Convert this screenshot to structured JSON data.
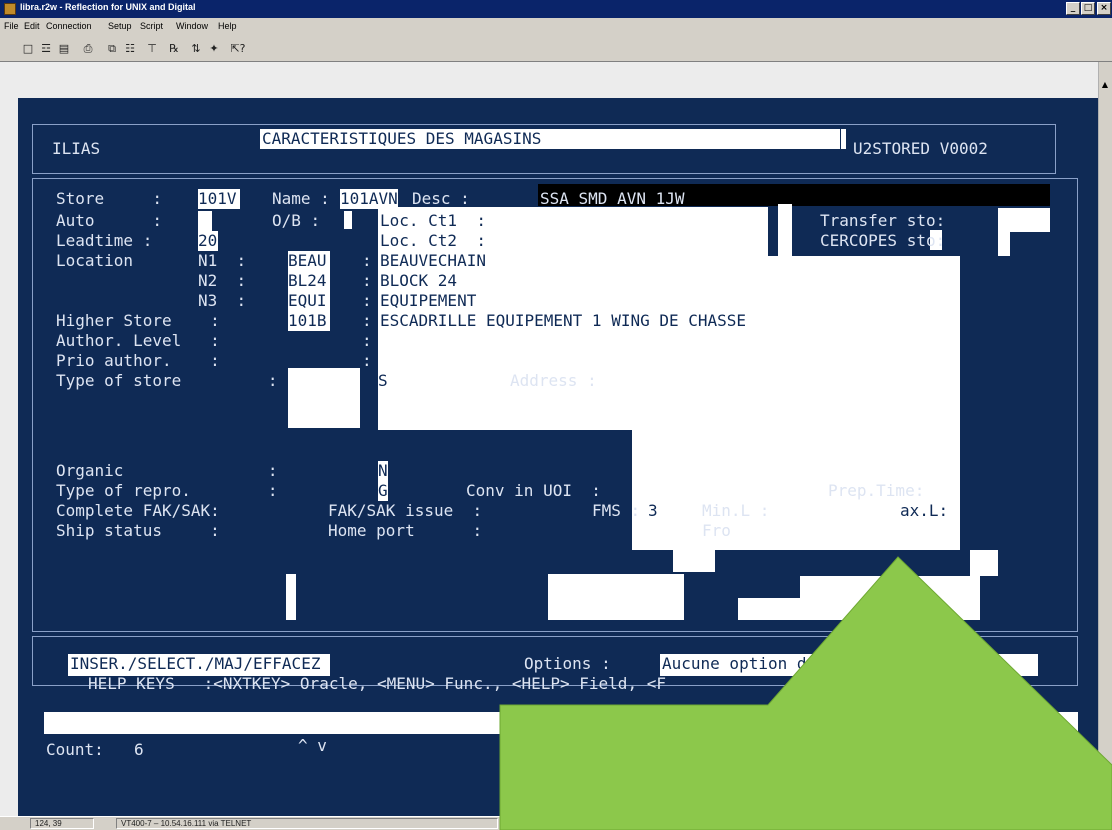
{
  "window": {
    "title": "libra.r2w - Reflection for UNIX and Digital",
    "buttons": [
      "_",
      "□",
      "×"
    ]
  },
  "menubar": [
    "File",
    "Edit",
    "Connection",
    "Setup",
    "Script",
    "Window",
    "Help"
  ],
  "toolbar": [
    "new-icon",
    "open-icon",
    "save-icon",
    "print-icon",
    "copy-icon",
    "paste-icon",
    "connect-icon",
    "settings-icon",
    "transfer-icon",
    "macro-icon",
    "help-icon"
  ],
  "header": {
    "app": "ILIAS",
    "screen_title": "CARACTERISTIQUES DES MAGASINS",
    "screen_code": "U2STORED V0002"
  },
  "form": {
    "store_label": "Store     :",
    "store_value": "101V",
    "name_label": "Name :",
    "name_value": "101AVN",
    "desc_label": "Desc :",
    "desc_value": "SSA SMD AVN 1JW",
    "auto_label": "Auto      :",
    "ob_label": "O/B :",
    "loc_ct1_label": "Loc. Ct1  :",
    "transfer_label": "Transfer sto:",
    "leadtime_label": "Leadtime :",
    "leadtime_value": "20",
    "loc_ct2_label": "Loc. Ct2  :",
    "cercopes_label": "CERCOPES sto:",
    "location_label": "Location",
    "n1_label": "N1  :",
    "n1_code": "BEAU",
    "n1_name": "BEAUVECHAIN",
    "n2_label": "N2  :",
    "n2_code": "BL24",
    "n2_name": "BLOCK 24",
    "n3_label": "N3  :",
    "n3_code": "EQUI",
    "n3_name": "EQUIPEMENT",
    "higher_store_label": "Higher Store    :",
    "higher_store_code": "101B",
    "higher_store_name": "ESCADRILLE EQUIPEMENT 1 WING DE CHASSE",
    "author_level_label": "Author. Level   :",
    "prio_author_label": "Prio author.    :",
    "type_of_store_label": "Type of store         :",
    "type_of_store_value": "S",
    "address_label": "Address :",
    "organic_label": "Organic               :",
    "organic_value": "N",
    "type_repro_label": "Type of repro.        :",
    "type_repro_value": "G",
    "conv_label": "Conv in UOI  :",
    "prep_time_label": "Prep.Time:",
    "complete_fak_label": "Complete FAK/SAK:",
    "fak_issue_label": "FAK/SAK issue  :",
    "fms_label": "FMS :",
    "fms_value": "3",
    "minl_label": "Min.L :",
    "maxl_label": "ax.L:",
    "ship_status_label": "Ship status     :",
    "home_port_label": "Home port      :",
    "fro_label": "Fro",
    "colon": ":"
  },
  "bottom": {
    "mode": "INSER./SELECT./MAJ/EFFACEZ",
    "options_label": "Options :",
    "options_value": "Aucune option di",
    "help_line": "HELP KEYS   :<NXTKEY> Oracle, <MENU> Func., <HELP> Field, <F",
    "count_label": "Count:",
    "count_value": "6",
    "nav": "^ v"
  },
  "statusbar": {
    "cursor": "124, 39",
    "connection": "VT400-7 – 10.54.16.111 via TELNET"
  },
  "colors": {
    "terminal_bg": "#0f2a55",
    "terminal_fg": "#dde4f2",
    "overlay_arrow": "#8cc84b"
  }
}
